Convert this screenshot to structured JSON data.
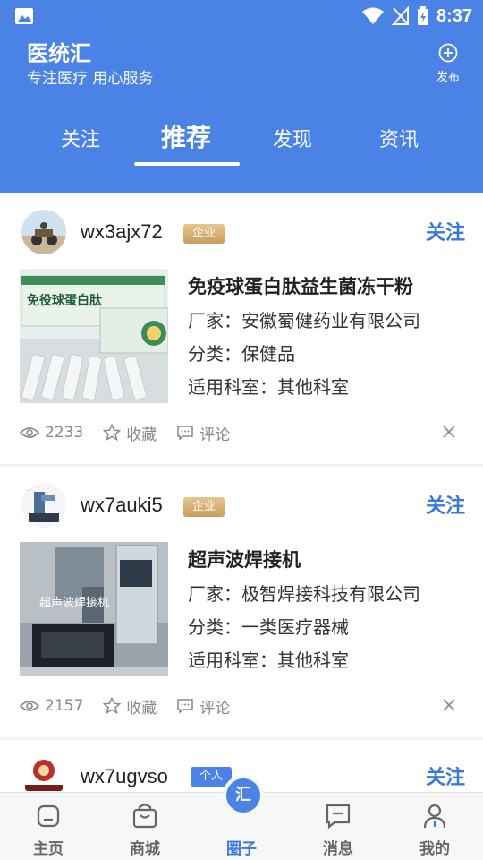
{
  "statusbar": {
    "time": "8:37"
  },
  "header": {
    "app_title": "医统汇",
    "app_subtitle": "专注医疗 用心服务",
    "publish_label": "发布"
  },
  "tabs": [
    {
      "label": "关注",
      "active": false
    },
    {
      "label": "推荐",
      "active": true
    },
    {
      "label": "发现",
      "active": false
    },
    {
      "label": "资讯",
      "active": false
    }
  ],
  "posts": [
    {
      "username": "wx3ajx72",
      "badge": "企业",
      "follow_label": "关注",
      "product_title": "免疫球蛋白肽益生菌冻干粉",
      "manufacturer": "厂家：安徽蜀健药业有限公司",
      "category": "分类：保健品",
      "department": "适用科室：其他科室",
      "views": "2233",
      "favorite_label": "收藏",
      "comment_label": "评论"
    },
    {
      "username": "wx7auki5",
      "badge": "企业",
      "follow_label": "关注",
      "product_title": "超声波焊接机",
      "manufacturer": "厂家：极智焊接科技有限公司",
      "category": "分类：一类医疗器械",
      "department": "适用科室：其他科室",
      "views": "2157",
      "favorite_label": "收藏",
      "comment_label": "评论"
    },
    {
      "username": "wx7ugvso",
      "badge": "个人",
      "follow_label": "关注"
    }
  ],
  "bottom_nav": [
    {
      "label": "主页",
      "icon": "home-icon",
      "active": false
    },
    {
      "label": "商城",
      "icon": "shop-bag-icon",
      "active": false
    },
    {
      "label": "圈子",
      "icon": "circle-hui-icon",
      "active": true,
      "center_glyph": "汇"
    },
    {
      "label": "消息",
      "icon": "message-icon",
      "active": false
    },
    {
      "label": "我的",
      "icon": "profile-icon",
      "active": false
    }
  ],
  "colors": {
    "primary": "#4a82e6",
    "follow": "#3a78de",
    "enterprise_badge": "#d4aa6c"
  }
}
